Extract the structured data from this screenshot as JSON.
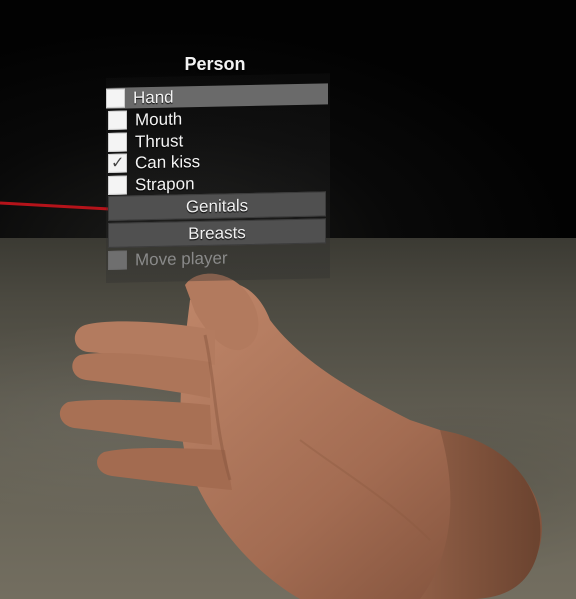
{
  "menu": {
    "title": "Person",
    "options": [
      {
        "label": "Hand",
        "checked": false,
        "highlighted": true
      },
      {
        "label": "Mouth",
        "checked": false
      },
      {
        "label": "Thrust",
        "checked": false
      },
      {
        "label": "Can kiss",
        "checked": true
      },
      {
        "label": "Strapon",
        "checked": false
      }
    ],
    "buttons": [
      {
        "label": "Genitals"
      },
      {
        "label": "Breasts"
      }
    ],
    "disabled_option": {
      "label": "Move player",
      "checked": false,
      "enabled": false
    }
  },
  "colors": {
    "pointer_laser": "#c8141c",
    "highlight_row": "#6a6a6a",
    "button": "#505050"
  }
}
